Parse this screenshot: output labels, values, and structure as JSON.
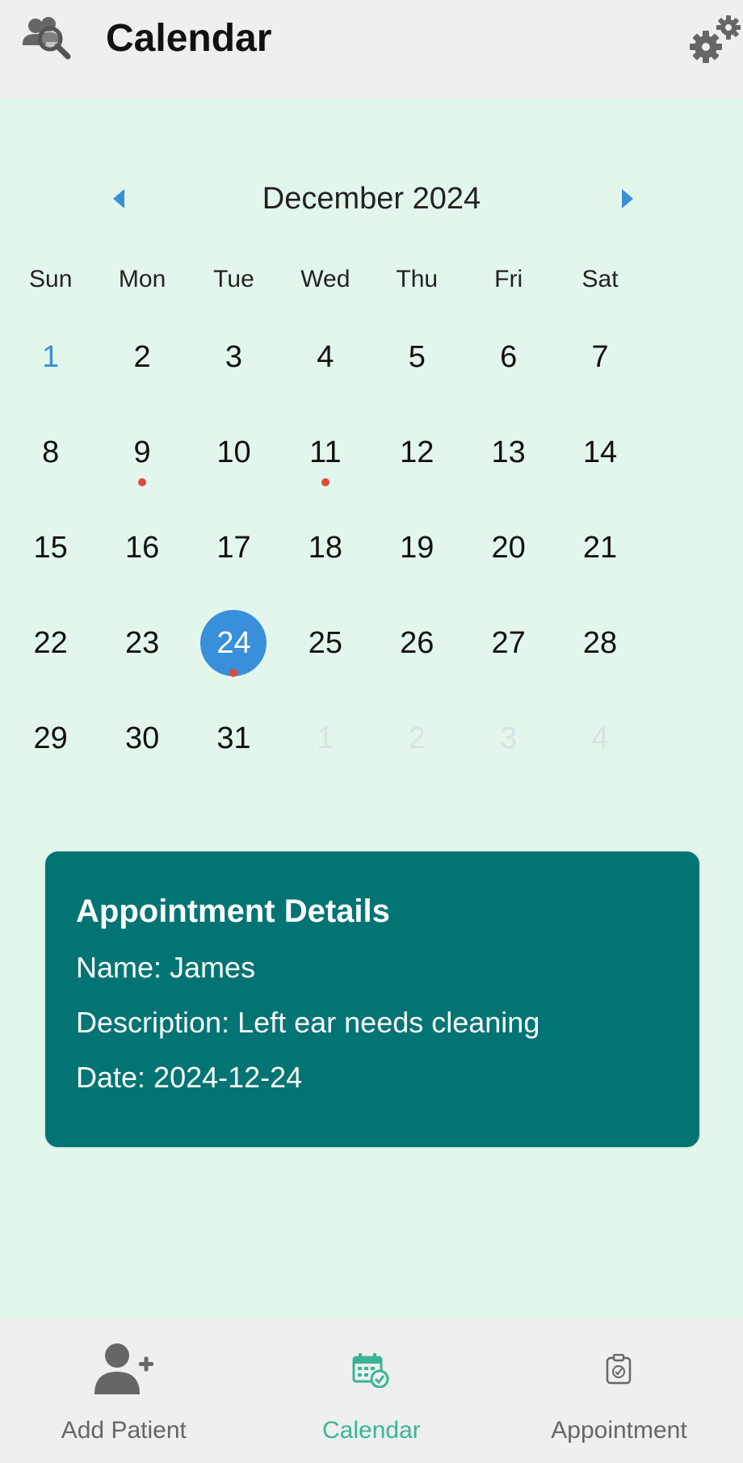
{
  "header": {
    "title": "Calendar"
  },
  "calendar": {
    "month_label": "December 2024",
    "weekdays": [
      "Sun",
      "Mon",
      "Tue",
      "Wed",
      "Thu",
      "Fri",
      "Sat"
    ],
    "weeks": [
      [
        {
          "day": "1",
          "state": "current-first"
        },
        {
          "day": "2"
        },
        {
          "day": "3"
        },
        {
          "day": "4"
        },
        {
          "day": "5"
        },
        {
          "day": "6"
        },
        {
          "day": "7"
        }
      ],
      [
        {
          "day": "8"
        },
        {
          "day": "9",
          "dot": true
        },
        {
          "day": "10"
        },
        {
          "day": "11",
          "dot": true
        },
        {
          "day": "12"
        },
        {
          "day": "13"
        },
        {
          "day": "14"
        }
      ],
      [
        {
          "day": "15"
        },
        {
          "day": "16"
        },
        {
          "day": "17"
        },
        {
          "day": "18"
        },
        {
          "day": "19"
        },
        {
          "day": "20"
        },
        {
          "day": "21"
        }
      ],
      [
        {
          "day": "22"
        },
        {
          "day": "23"
        },
        {
          "day": "24",
          "selected": true,
          "dot": true
        },
        {
          "day": "25"
        },
        {
          "day": "26"
        },
        {
          "day": "27"
        },
        {
          "day": "28"
        }
      ],
      [
        {
          "day": "29"
        },
        {
          "day": "30"
        },
        {
          "day": "31"
        },
        {
          "day": "1",
          "state": "other-month"
        },
        {
          "day": "2",
          "state": "other-month"
        },
        {
          "day": "3",
          "state": "other-month"
        },
        {
          "day": "4",
          "state": "other-month"
        }
      ]
    ],
    "colors": {
      "selected": "#3a8fdb",
      "event_dot": "#e04a3a",
      "nav_arrow": "#3a90d6"
    }
  },
  "appointment": {
    "title": "Appointment Details",
    "name": "Name: James",
    "description": "Description: Left ear needs cleaning",
    "date": "Date: 2024-12-24"
  },
  "bottom_nav": {
    "tabs": [
      {
        "label": "Add Patient",
        "icon": "add-user-icon",
        "active": false
      },
      {
        "label": "Calendar",
        "icon": "calendar-check-icon",
        "active": true
      },
      {
        "label": "Appointment",
        "icon": "clipboard-check-icon",
        "active": false
      }
    ],
    "active_color": "#3ab496"
  }
}
